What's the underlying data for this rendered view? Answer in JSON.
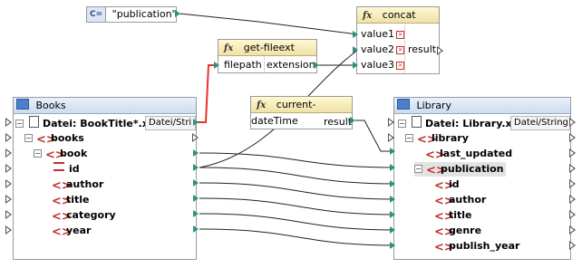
{
  "constant": {
    "badge": "C=",
    "value": "\"publication\""
  },
  "concat": {
    "fx": "fx",
    "title": "concat",
    "inputs": [
      "value1",
      "value2",
      "value3"
    ],
    "output": "result"
  },
  "get_fileext": {
    "fx": "fx",
    "title": "get-fileext",
    "input": "filepath",
    "output": "extension"
  },
  "current_datetime": {
    "fx": "fx",
    "title": "current-dateTime",
    "output": "result"
  },
  "books": {
    "title": "Books",
    "file_label": "Datei: BookTitle*.xml",
    "file_dropdown": "Datei/Stri",
    "nodes": {
      "books": "books",
      "book": "book",
      "id": "id",
      "author": "author",
      "title": "title",
      "category": "category",
      "year": "year"
    }
  },
  "library": {
    "title": "Library",
    "file_label": "Datei: Library.xml",
    "file_dropdown": "Datei/String",
    "nodes": {
      "library": "library",
      "last_updated": "last_updated",
      "publication": "publication",
      "id": "id",
      "author": "author",
      "title": "title",
      "genre": "genre",
      "publish_year": "publish_year"
    }
  },
  "colors": {
    "connector": "#2f8f85",
    "element_icon": "#c0302a",
    "highlight_wire": "#e8322a",
    "header_yellow": "#f6edbd",
    "header_blue": "#dbe6f5"
  }
}
